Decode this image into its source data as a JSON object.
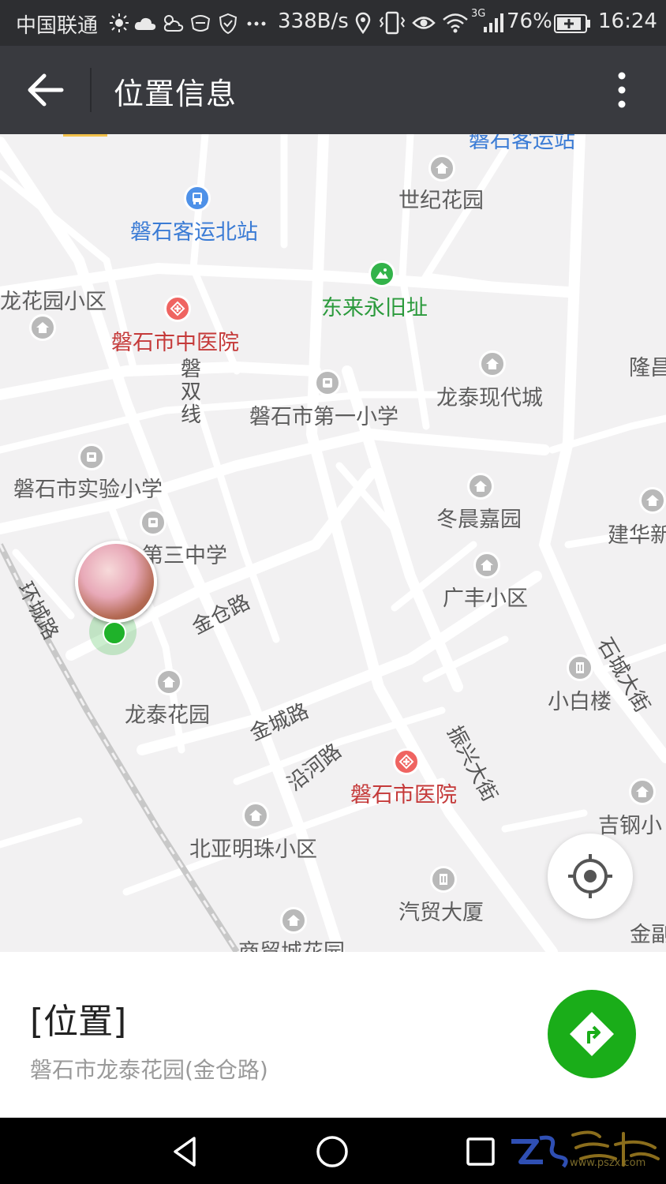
{
  "status_bar": {
    "carrier": "中国联通",
    "net_speed": "338B/s",
    "network_type": "3G",
    "battery": "76%",
    "time": "16:24"
  },
  "title_bar": {
    "title": "位置信息",
    "back_icon": "arrow-left-icon",
    "more_icon": "more-vertical-icon"
  },
  "map": {
    "pois": [
      {
        "label": "磐石客运站"
      },
      {
        "label": "世纪花园"
      },
      {
        "label": "磐石客运北站"
      },
      {
        "label": "东来永旧址"
      },
      {
        "label": "龙花园小区"
      },
      {
        "label": "磐石市中医院"
      },
      {
        "label": "磐石市第一小学"
      },
      {
        "label": "龙泰现代城"
      },
      {
        "label": "隆昌"
      },
      {
        "label": "磐石市实验小学"
      },
      {
        "label": "冬晨嘉园"
      },
      {
        "label": "建华新"
      },
      {
        "label": "第三中学"
      },
      {
        "label": "广丰小区"
      },
      {
        "label": "小白楼"
      },
      {
        "label": "龙泰花园"
      },
      {
        "label": "磐石市医院"
      },
      {
        "label": "吉钢小"
      },
      {
        "label": "北亚明珠小区"
      },
      {
        "label": "汽贸大厦"
      },
      {
        "label": "金副"
      },
      {
        "label": "商贸城花园"
      }
    ],
    "roads": {
      "pan_shuang": "磐双线",
      "huan_cheng": "环城路",
      "jin_cang": "金仓路",
      "jin_cheng": "金城路",
      "yan_he": "沿河路",
      "zhen_xing": "振兴大街",
      "shi_cheng": "石城大街"
    },
    "locate_icon": "locate-crosshair-icon"
  },
  "location_panel": {
    "name": "[位置]",
    "address": "磐石市龙泰花园(金仓路)",
    "route_icon": "route-navigation-icon"
  },
  "nav_bar": {
    "back_icon": "nav-back-triangle-icon",
    "home_icon": "nav-home-circle-icon",
    "recents_icon": "nav-recents-square-icon",
    "watermark_url": "www.pszx.com"
  },
  "colors": {
    "status_bar": "#2d2e31",
    "title_bar": "#393a3f",
    "map_bg": "#f2f1f2",
    "accent_green": "#1aad19",
    "poi_red": "#c53a3a",
    "poi_blue": "#3a7bd5"
  }
}
